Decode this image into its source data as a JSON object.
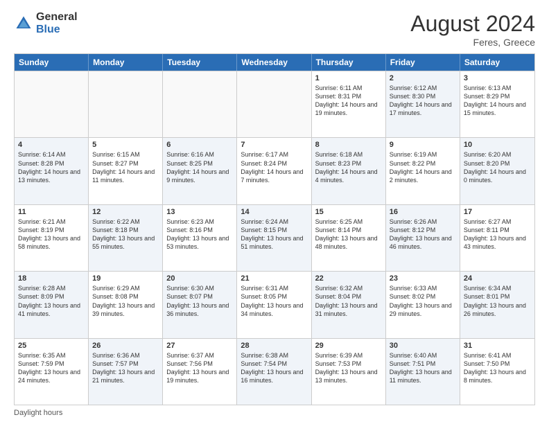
{
  "logo": {
    "general": "General",
    "blue": "Blue"
  },
  "title": "August 2024",
  "location": "Feres, Greece",
  "header_days": [
    "Sunday",
    "Monday",
    "Tuesday",
    "Wednesday",
    "Thursday",
    "Friday",
    "Saturday"
  ],
  "weeks": [
    [
      {
        "day": "",
        "empty": true,
        "content": ""
      },
      {
        "day": "",
        "empty": true,
        "content": ""
      },
      {
        "day": "",
        "empty": true,
        "content": ""
      },
      {
        "day": "",
        "empty": true,
        "content": ""
      },
      {
        "day": "1",
        "content": "Sunrise: 6:11 AM\nSunset: 8:31 PM\nDaylight: 14 hours\nand 19 minutes."
      },
      {
        "day": "2",
        "content": "Sunrise: 6:12 AM\nSunset: 8:30 PM\nDaylight: 14 hours\nand 17 minutes."
      },
      {
        "day": "3",
        "content": "Sunrise: 6:13 AM\nSunset: 8:29 PM\nDaylight: 14 hours\nand 15 minutes."
      }
    ],
    [
      {
        "day": "4",
        "content": "Sunrise: 6:14 AM\nSunset: 8:28 PM\nDaylight: 14 hours\nand 13 minutes."
      },
      {
        "day": "5",
        "content": "Sunrise: 6:15 AM\nSunset: 8:27 PM\nDaylight: 14 hours\nand 11 minutes."
      },
      {
        "day": "6",
        "content": "Sunrise: 6:16 AM\nSunset: 8:25 PM\nDaylight: 14 hours\nand 9 minutes."
      },
      {
        "day": "7",
        "content": "Sunrise: 6:17 AM\nSunset: 8:24 PM\nDaylight: 14 hours\nand 7 minutes."
      },
      {
        "day": "8",
        "content": "Sunrise: 6:18 AM\nSunset: 8:23 PM\nDaylight: 14 hours\nand 4 minutes."
      },
      {
        "day": "9",
        "content": "Sunrise: 6:19 AM\nSunset: 8:22 PM\nDaylight: 14 hours\nand 2 minutes."
      },
      {
        "day": "10",
        "content": "Sunrise: 6:20 AM\nSunset: 8:20 PM\nDaylight: 14 hours\nand 0 minutes."
      }
    ],
    [
      {
        "day": "11",
        "content": "Sunrise: 6:21 AM\nSunset: 8:19 PM\nDaylight: 13 hours\nand 58 minutes."
      },
      {
        "day": "12",
        "content": "Sunrise: 6:22 AM\nSunset: 8:18 PM\nDaylight: 13 hours\nand 55 minutes."
      },
      {
        "day": "13",
        "content": "Sunrise: 6:23 AM\nSunset: 8:16 PM\nDaylight: 13 hours\nand 53 minutes."
      },
      {
        "day": "14",
        "content": "Sunrise: 6:24 AM\nSunset: 8:15 PM\nDaylight: 13 hours\nand 51 minutes."
      },
      {
        "day": "15",
        "content": "Sunrise: 6:25 AM\nSunset: 8:14 PM\nDaylight: 13 hours\nand 48 minutes."
      },
      {
        "day": "16",
        "content": "Sunrise: 6:26 AM\nSunset: 8:12 PM\nDaylight: 13 hours\nand 46 minutes."
      },
      {
        "day": "17",
        "content": "Sunrise: 6:27 AM\nSunset: 8:11 PM\nDaylight: 13 hours\nand 43 minutes."
      }
    ],
    [
      {
        "day": "18",
        "content": "Sunrise: 6:28 AM\nSunset: 8:09 PM\nDaylight: 13 hours\nand 41 minutes."
      },
      {
        "day": "19",
        "content": "Sunrise: 6:29 AM\nSunset: 8:08 PM\nDaylight: 13 hours\nand 39 minutes."
      },
      {
        "day": "20",
        "content": "Sunrise: 6:30 AM\nSunset: 8:07 PM\nDaylight: 13 hours\nand 36 minutes."
      },
      {
        "day": "21",
        "content": "Sunrise: 6:31 AM\nSunset: 8:05 PM\nDaylight: 13 hours\nand 34 minutes."
      },
      {
        "day": "22",
        "content": "Sunrise: 6:32 AM\nSunset: 8:04 PM\nDaylight: 13 hours\nand 31 minutes."
      },
      {
        "day": "23",
        "content": "Sunrise: 6:33 AM\nSunset: 8:02 PM\nDaylight: 13 hours\nand 29 minutes."
      },
      {
        "day": "24",
        "content": "Sunrise: 6:34 AM\nSunset: 8:01 PM\nDaylight: 13 hours\nand 26 minutes."
      }
    ],
    [
      {
        "day": "25",
        "content": "Sunrise: 6:35 AM\nSunset: 7:59 PM\nDaylight: 13 hours\nand 24 minutes."
      },
      {
        "day": "26",
        "content": "Sunrise: 6:36 AM\nSunset: 7:57 PM\nDaylight: 13 hours\nand 21 minutes."
      },
      {
        "day": "27",
        "content": "Sunrise: 6:37 AM\nSunset: 7:56 PM\nDaylight: 13 hours\nand 19 minutes."
      },
      {
        "day": "28",
        "content": "Sunrise: 6:38 AM\nSunset: 7:54 PM\nDaylight: 13 hours\nand 16 minutes."
      },
      {
        "day": "29",
        "content": "Sunrise: 6:39 AM\nSunset: 7:53 PM\nDaylight: 13 hours\nand 13 minutes."
      },
      {
        "day": "30",
        "content": "Sunrise: 6:40 AM\nSunset: 7:51 PM\nDaylight: 13 hours\nand 11 minutes."
      },
      {
        "day": "31",
        "content": "Sunrise: 6:41 AM\nSunset: 7:50 PM\nDaylight: 13 hours\nand 8 minutes."
      }
    ]
  ],
  "footer": "Daylight hours"
}
